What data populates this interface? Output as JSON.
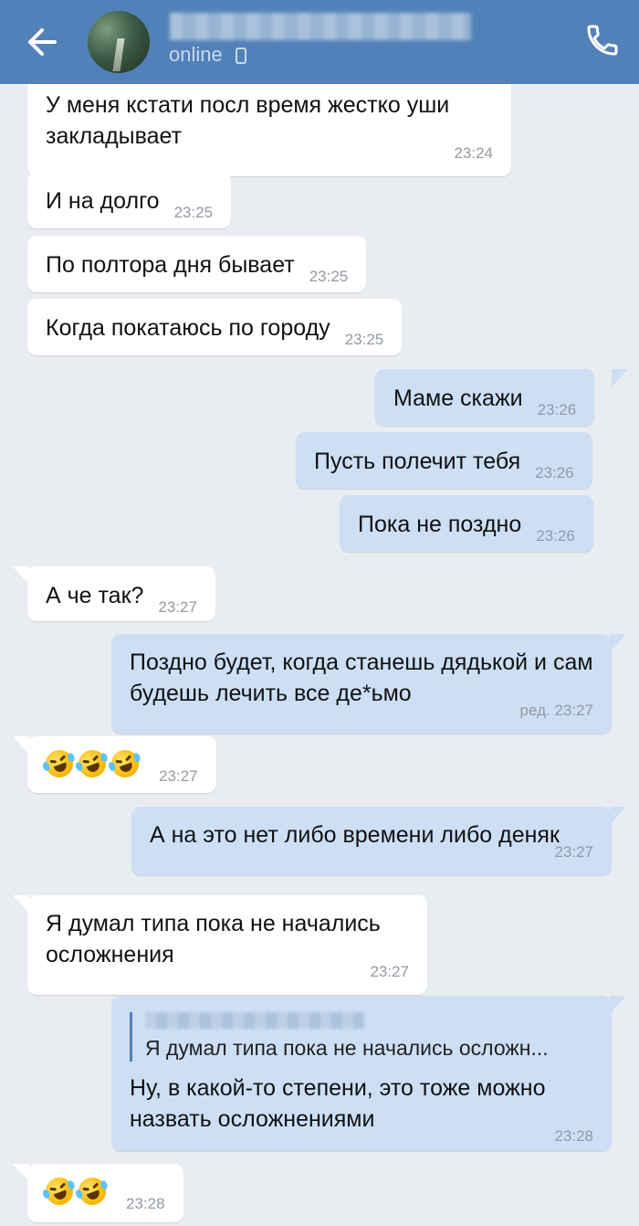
{
  "header": {
    "status": "online",
    "name_hidden": true
  },
  "messages": [
    {
      "dir": "in",
      "text": "У меня кстати посл время жестко уши закладывает",
      "time": "23:24"
    },
    {
      "dir": "in",
      "text": "И на долго",
      "time": "23:25"
    },
    {
      "dir": "in",
      "text": "По полтора дня бывает",
      "time": "23:25"
    },
    {
      "dir": "in",
      "text": "Когда покатаюсь по городу",
      "time": "23:25"
    },
    {
      "dir": "out",
      "text": "Маме скажи",
      "time": "23:26"
    },
    {
      "dir": "out",
      "text": "Пусть полечит тебя",
      "time": "23:26"
    },
    {
      "dir": "out",
      "text": "Пока не поздно",
      "time": "23:26"
    },
    {
      "dir": "in",
      "text": "А че так?",
      "time": "23:27"
    },
    {
      "dir": "out",
      "text": "Поздно будет, когда станешь дядькой и сам будешь лечить все де*ьмо",
      "time": "ред. 23:27"
    },
    {
      "dir": "in",
      "emoji": [
        "rolling-on-floor-laughing",
        "rolling-on-floor-laughing",
        "rolling-on-floor-laughing"
      ],
      "time": "23:27"
    },
    {
      "dir": "out",
      "text": "А на это нет либо времени либо деняк",
      "time": "23:27"
    },
    {
      "dir": "in",
      "text": "Я думал типа пока не начались осложнения",
      "time": "23:27"
    },
    {
      "dir": "out",
      "quote": "Я думал типа пока не начались осложн...",
      "text": "Ну, в какой-то степени, это тоже можно назвать осложнениями",
      "time": "23:28"
    },
    {
      "dir": "in",
      "emoji": [
        "rolling-on-floor-laughing",
        "rolling-on-floor-laughing"
      ],
      "time": "23:28"
    }
  ],
  "colors": {
    "header_bg": "#5181b8",
    "chat_bg": "#e9edf2",
    "incoming_bubble": "#ffffff",
    "outgoing_bubble": "#cddff5",
    "timestamp": "#939aa2"
  },
  "icons": {
    "back": "arrow-left-icon",
    "device": "mobile-phone-icon",
    "call": "phone-icon",
    "emoji": "rolling-on-floor-laughing-emoji"
  }
}
